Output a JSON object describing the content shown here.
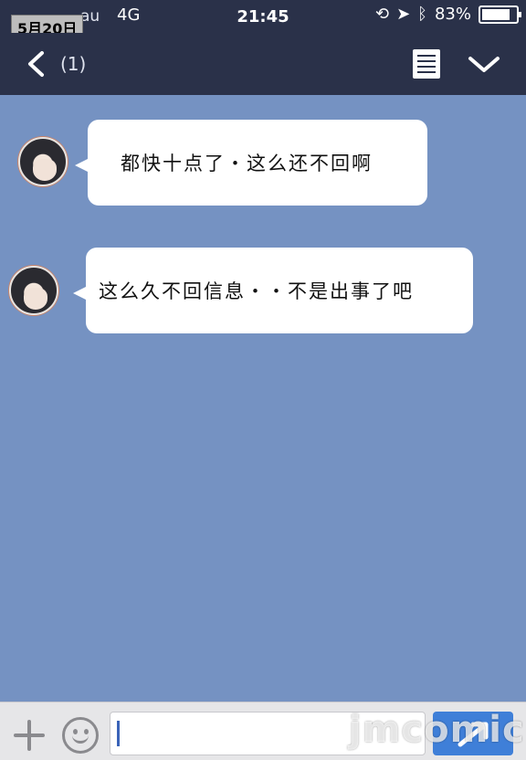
{
  "status_bar": {
    "date_stamp": "5月20日",
    "carrier": "au",
    "network": "4G",
    "time": "21:45",
    "battery": "83%",
    "battery_level": 0.83
  },
  "nav": {
    "back_count": "(1)"
  },
  "messages": [
    {
      "text": "都快十点了・这么还不回啊"
    },
    {
      "text": "这么久不回信息・・不是出事了吧"
    }
  ],
  "input": {
    "value": ""
  },
  "watermark": "jmcomic",
  "colors": {
    "chat_background": "#7592c2",
    "header": "#2a3149",
    "send_button": "#3f7fd8"
  }
}
